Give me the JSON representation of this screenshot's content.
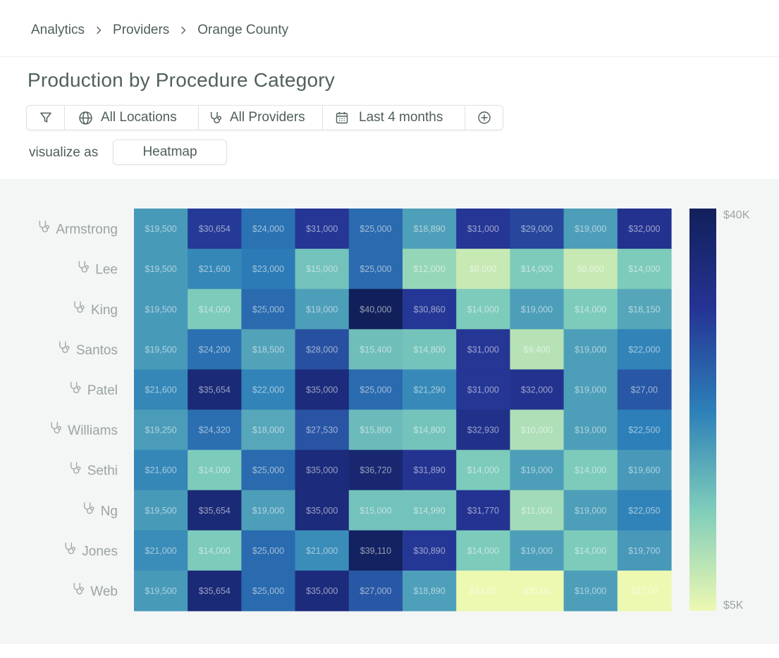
{
  "breadcrumb": {
    "items": [
      "Analytics",
      "Providers",
      "Orange County"
    ]
  },
  "page": {
    "title": "Production by Procedure Category"
  },
  "filters": {
    "locations_label": "All Locations",
    "providers_label": "All Providers",
    "date_label": "Last 4 months"
  },
  "visualize": {
    "label": "visualize as",
    "value": "Heatmap"
  },
  "icons": {
    "filter": "filter-icon",
    "globe": "globe-icon",
    "stethoscope": "stethoscope-icon",
    "calendar": "calendar-icon",
    "add": "plus-circle-icon",
    "chevron": "chevron-right-icon"
  },
  "colors": {
    "panel_bg": "#f4f6f5",
    "text": "#4f5f59",
    "scale": [
      "#edf8b1",
      "#7fcdbb",
      "#2c7fb8",
      "#253494",
      "#11205a"
    ]
  },
  "chart_data": {
    "type": "heatmap",
    "rows": [
      "Armstrong",
      "Lee",
      "King",
      "Santos",
      "Patel",
      "Williams",
      "Sethi",
      "Ng",
      "Jones",
      "Web"
    ],
    "columns_count": 10,
    "values": [
      [
        19500,
        30654,
        24000,
        31000,
        25000,
        18890,
        31000,
        29000,
        19000,
        32000
      ],
      [
        19500,
        21600,
        23000,
        15000,
        25000,
        12000,
        8000,
        14000,
        8000,
        14000
      ],
      [
        19500,
        14000,
        25000,
        19000,
        40000,
        30860,
        14000,
        19000,
        14000,
        18150
      ],
      [
        19500,
        24200,
        18500,
        28000,
        15400,
        14800,
        31000,
        9400,
        19000,
        22000
      ],
      [
        21600,
        35654,
        22000,
        35000,
        25000,
        21290,
        31000,
        32000,
        19000,
        27000
      ],
      [
        19250,
        24320,
        18000,
        27530,
        15800,
        14800,
        32930,
        10000,
        19000,
        22500
      ],
      [
        21600,
        14000,
        25000,
        35000,
        36720,
        31890,
        14000,
        19000,
        14000,
        19600
      ],
      [
        19500,
        35654,
        19000,
        35000,
        15000,
        14990,
        31770,
        11000,
        19000,
        22050
      ],
      [
        21000,
        14000,
        25000,
        21000,
        39110,
        30890,
        14000,
        19000,
        14000,
        19700
      ],
      [
        19500,
        35654,
        25000,
        35000,
        27000,
        18890,
        3400,
        3500,
        19000,
        2700
      ]
    ],
    "labels": [
      [
        "$19,500",
        "$30,654",
        "$24,000",
        "$31,000",
        "$25,000",
        "$18,890",
        "$31,000",
        "$29,000",
        "$19,000",
        "$32,000"
      ],
      [
        "$19,500",
        "$21,600",
        "$23,000",
        "$15,000",
        "$25,000",
        "$12,000",
        "$8,000",
        "$14,000",
        "$8,000",
        "$14,000"
      ],
      [
        "$19,500",
        "$14,000",
        "$25,000",
        "$19,000",
        "$40,000",
        "$30,860",
        "$14,000",
        "$19,000",
        "$14,000",
        "$18,150"
      ],
      [
        "$19,500",
        "$24,200",
        "$18,500",
        "$28,000",
        "$15,400",
        "$14,800",
        "$31,000",
        "$9,400",
        "$19,000",
        "$22,000"
      ],
      [
        "$21,600",
        "$35,654",
        "$22,000",
        "$35,000",
        "$25,000",
        "$21,290",
        "$31,000",
        "$32,000",
        "$19,000",
        "$27,00"
      ],
      [
        "$19,250",
        "$24,320",
        "$18,000",
        "$27,530",
        "$15,800",
        "$14,800",
        "$32,930",
        "$10,000",
        "$19,000",
        "$22,500"
      ],
      [
        "$21,600",
        "$14,000",
        "$25,000",
        "$35,000",
        "$36,720",
        "$31,890",
        "$14,000",
        "$19,000",
        "$14,000",
        "$19,600"
      ],
      [
        "$19,500",
        "$35,654",
        "$19,000",
        "$35,000",
        "$15,000",
        "$14,990",
        "$31,770",
        "$11,000",
        "$19,000",
        "$22,050"
      ],
      [
        "$21,000",
        "$14,000",
        "$25,000",
        "$21,000",
        "$39,110",
        "$30,890",
        "$14,000",
        "$19,000",
        "$14,000",
        "$19,700"
      ],
      [
        "$19,500",
        "$35,654",
        "$25,000",
        "$35,000",
        "$27,000",
        "$18,890",
        "$34,00",
        "$35,00",
        "$19,000",
        "$27,00"
      ]
    ],
    "colorbar": {
      "min_label": "$5K",
      "max_label": "$40K",
      "min": 5000,
      "max": 40000
    }
  }
}
